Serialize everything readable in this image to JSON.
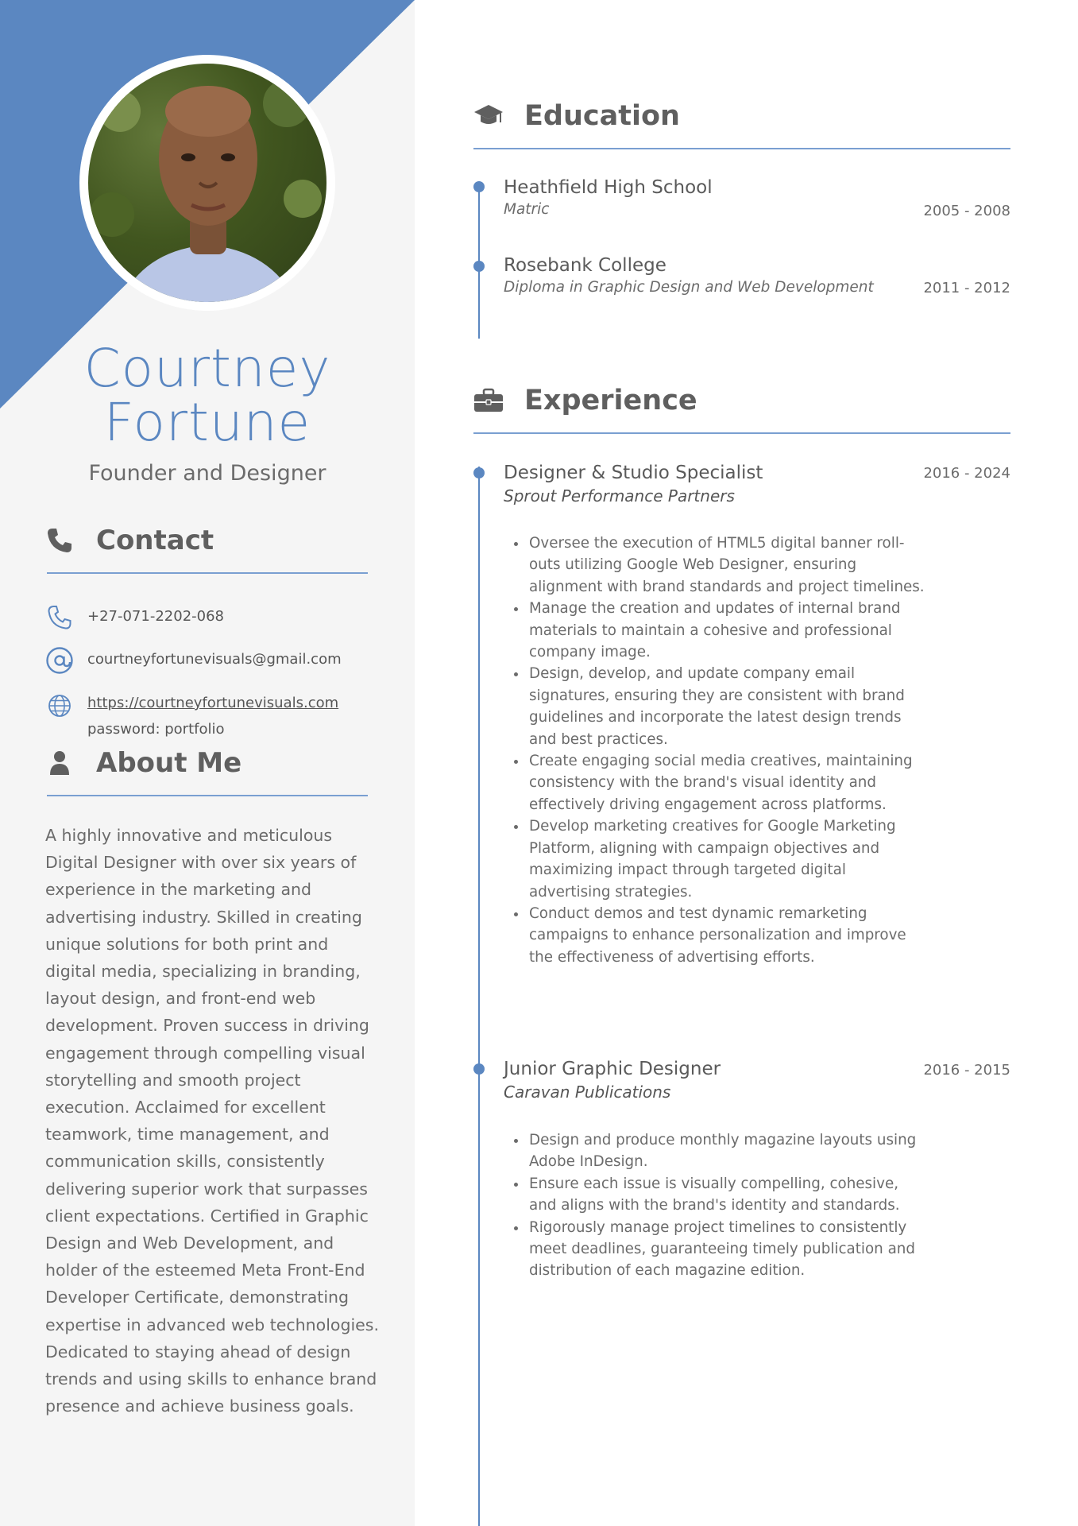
{
  "colors": {
    "accent": "#5b87c1",
    "sidebar_bg": "#f5f5f5",
    "heading": "#5f5f5f",
    "text": "#6b6b6b"
  },
  "profile": {
    "first_name": "Courtney",
    "last_name": "Fortune",
    "role": "Founder and Designer"
  },
  "contact": {
    "heading": "Contact",
    "heading_icon": "phone-icon",
    "phone": "+27-071-2202-068",
    "phone_icon": "phone-handset-icon",
    "email": "courtneyfortunevisuals@gmail.com",
    "email_icon": "at-sign-icon",
    "website": "https://courtneyfortunevisuals.com",
    "website_icon": "globe-icon",
    "password": "password: portfolio"
  },
  "about": {
    "heading": "About Me",
    "heading_icon": "user-icon",
    "text": "A highly innovative and meticulous Digital Designer with over six years of experience in the marketing and advertising industry. Skilled in creating unique solutions for both print and digital media, specializing in branding, layout design, and front-end web development. Proven success in driving engagement through compelling visual storytelling and smooth project execution. Acclaimed for excellent teamwork, time management, and communication skills, consistently delivering superior work that surpasses client expectations. Certified in Graphic Design and Web Development, and holder of the esteemed Meta Front-End Developer Certificate, demonstrating expertise in advanced web technologies. Dedicated to staying ahead of design trends and using skills to enhance brand presence and achieve business goals."
  },
  "education": {
    "heading": "Education",
    "heading_icon": "graduation-cap-icon",
    "items": [
      {
        "school": "Heathfield High School",
        "qualification": "Matric",
        "dates": "2005 - 2008"
      },
      {
        "school": "Rosebank College",
        "qualification": "Diploma in Graphic Design and Web Development",
        "dates": "2011 - 2012"
      }
    ]
  },
  "experience": {
    "heading": "Experience",
    "heading_icon": "briefcase-icon",
    "items": [
      {
        "title": "Designer & Studio Specialist",
        "company": "Sprout Performance Partners",
        "dates": "2016 - 2024",
        "bullets": [
          "Oversee the execution of HTML5 digital banner roll-outs utilizing Google Web Designer, ensuring alignment with brand standards and project timelines.",
          "Manage the creation and updates of internal brand materials to maintain a cohesive and professional company image.",
          "Design, develop, and update company email signatures, ensuring they are consistent with brand guidelines and incorporate the latest design trends and best practices.",
          "Create engaging social media creatives, maintaining consistency with the brand's visual identity and effectively driving engagement across platforms.",
          "Develop marketing creatives for Google Marketing Platform, aligning with campaign objectives and maximizing impact through targeted digital advertising strategies.",
          "Conduct demos and test dynamic remarketing campaigns to enhance personalization and improve the effectiveness of advertising efforts."
        ]
      },
      {
        "title": "Junior Graphic Designer",
        "company": "Caravan Publications",
        "dates": "2016 - 2015",
        "bullets": [
          "Design and produce monthly magazine layouts using Adobe InDesign.",
          "Ensure each issue is visually compelling, cohesive, and aligns with the brand's identity and standards.",
          "Rigorously manage project timelines to consistently meet deadlines, guaranteeing timely publication and distribution of each magazine edition."
        ]
      }
    ]
  }
}
